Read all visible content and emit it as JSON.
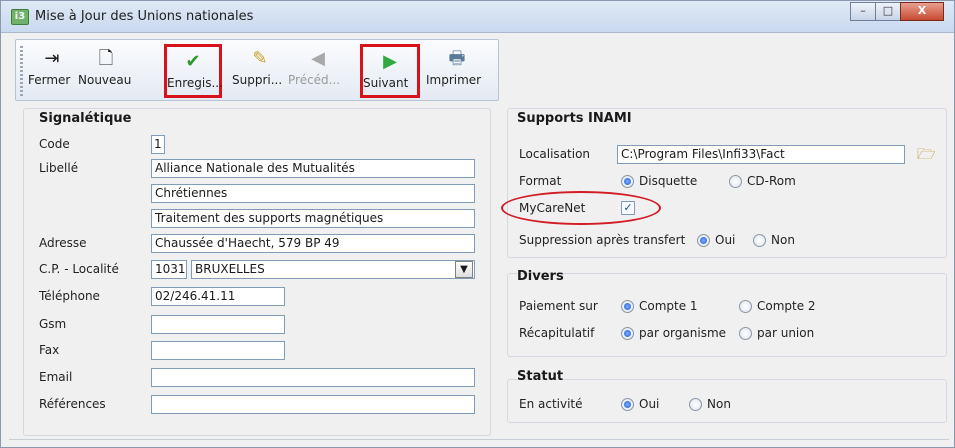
{
  "window": {
    "title": "Mise à Jour des Unions nationales",
    "app_icon_text": "i3",
    "buttons": {
      "minimize": "–",
      "maximize": "□",
      "close": "X"
    }
  },
  "toolbar": {
    "buttons": [
      {
        "label": "Fermer",
        "icon": "exit-door-icon",
        "glyph": "⇥",
        "enabled": true,
        "highlighted": false
      },
      {
        "label": "Nouveau",
        "icon": "new-document-icon",
        "glyph": "🗋",
        "enabled": true,
        "highlighted": false
      },
      {
        "label": "Enregis...",
        "icon": "checkmark-icon",
        "glyph": "✔",
        "enabled": true,
        "highlighted": true
      },
      {
        "label": "Suppri...",
        "icon": "eraser-icon",
        "glyph": "✎",
        "enabled": true,
        "highlighted": false
      },
      {
        "label": "Précéd...",
        "icon": "arrow-left-icon",
        "glyph": "◀",
        "enabled": false,
        "highlighted": false
      },
      {
        "label": "Suivant",
        "icon": "arrow-right-icon",
        "glyph": "▶",
        "enabled": true,
        "highlighted": true
      },
      {
        "label": "Imprimer",
        "icon": "printer-icon",
        "glyph": "🖶",
        "enabled": true,
        "highlighted": false
      }
    ]
  },
  "signaletique": {
    "title": "Signalétique",
    "code_label": "Code",
    "code_value": "1",
    "libelle_label": "Libellé",
    "libelle_lines": [
      "Alliance Nationale des Mutualités",
      "Chrétiennes",
      "Traitement des supports magnétiques"
    ],
    "adresse_label": "Adresse",
    "adresse_value": "Chaussée d'Haecht, 579 BP 49",
    "cp_label": "C.P. - Localité",
    "cp_value": "1031",
    "localite_value": "BRUXELLES",
    "telephone_label": "Téléphone",
    "telephone_value": "02/246.41.11",
    "gsm_label": "Gsm",
    "gsm_value": "",
    "fax_label": "Fax",
    "fax_value": "",
    "email_label": "Email",
    "email_value": "",
    "references_label": "Références",
    "references_value": ""
  },
  "supports": {
    "title": "Supports INAMI",
    "localisation_label": "Localisation",
    "localisation_value": "C:\\Program Files\\Infi33\\Fact",
    "format_label": "Format",
    "format_options": [
      "Disquette",
      "CD-Rom"
    ],
    "format_selected": "Disquette",
    "mycarenet_label": "MyCareNet",
    "mycarenet_checked": true,
    "check_glyph": "✓",
    "suppression_label": "Suppression après transfert",
    "suppression_options": [
      "Oui",
      "Non"
    ],
    "suppression_selected": "Oui"
  },
  "divers": {
    "title": "Divers",
    "paiement_label": "Paiement sur",
    "paiement_options": [
      "Compte 1",
      "Compte 2"
    ],
    "paiement_selected": "Compte 1",
    "recap_label": "Récapitulatif",
    "recap_options": [
      "par organisme",
      "par union"
    ],
    "recap_selected": "par organisme"
  },
  "statut": {
    "title": "Statut",
    "activite_label": "En activité",
    "activite_options": [
      "Oui",
      "Non"
    ],
    "activite_selected": "Oui"
  },
  "colors": {
    "highlight": "#d8121b",
    "radio_on": "#1c56d6",
    "folder": "#b8860b"
  }
}
